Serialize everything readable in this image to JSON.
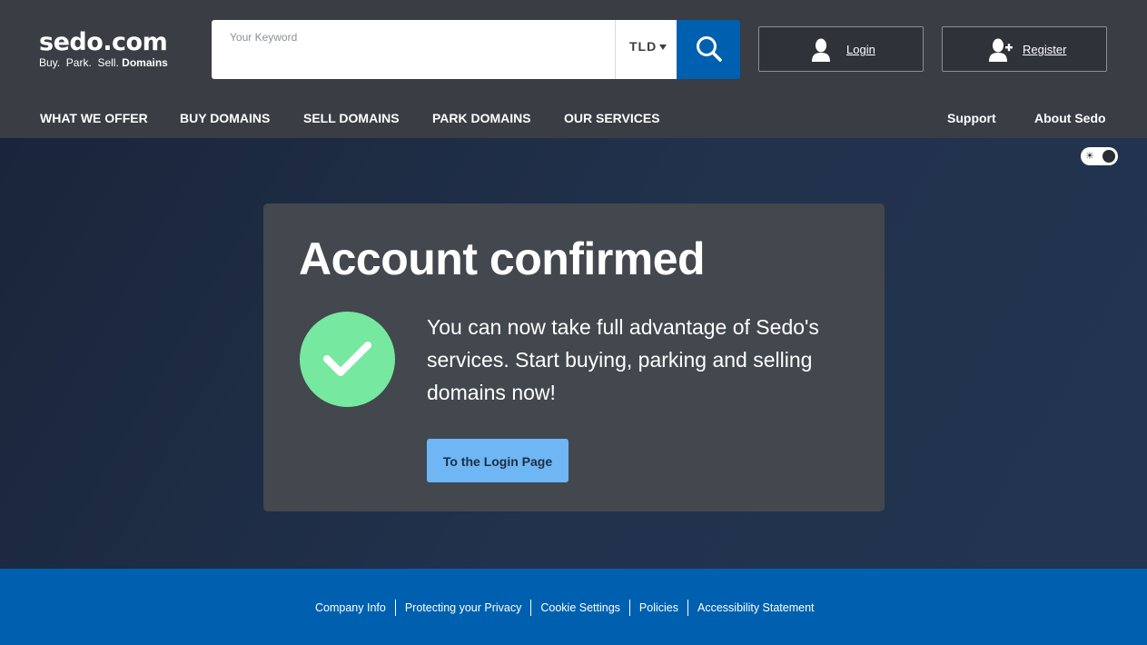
{
  "header": {
    "logo_main": "sedo.com",
    "logo_sub_plain": "Buy.  Park.  Sell.",
    "logo_sub_bold": "Domains",
    "search_placeholder": "Your Keyword",
    "tld_label": "TLD",
    "login_label": "Login",
    "register_label": "Register"
  },
  "nav": {
    "left": [
      "WHAT WE OFFER",
      "BUY DOMAINS",
      "SELL DOMAINS",
      "PARK DOMAINS",
      "OUR SERVICES"
    ],
    "right": [
      "Support",
      "About Sedo"
    ]
  },
  "card": {
    "title": "Account confirmed",
    "text": "You can now take full advantage of Sedo's services. Start buying, parking and selling domains now!",
    "button_label": "To the Login Page"
  },
  "footer": {
    "links": [
      "Company Info",
      "Protecting your Privacy",
      "Cookie Settings",
      "Policies",
      "Accessibility Statement"
    ]
  },
  "colors": {
    "header_bg": "#3a3d44",
    "search_button": "#0060b0",
    "check_green": "#76e89f",
    "login_page_button": "#6fb6f5",
    "footer_bg": "#0060b0"
  },
  "icons": {
    "search": "search-icon",
    "login": "user-icon",
    "register": "user-plus-icon",
    "theme": "sun-icon",
    "check": "check-icon"
  }
}
